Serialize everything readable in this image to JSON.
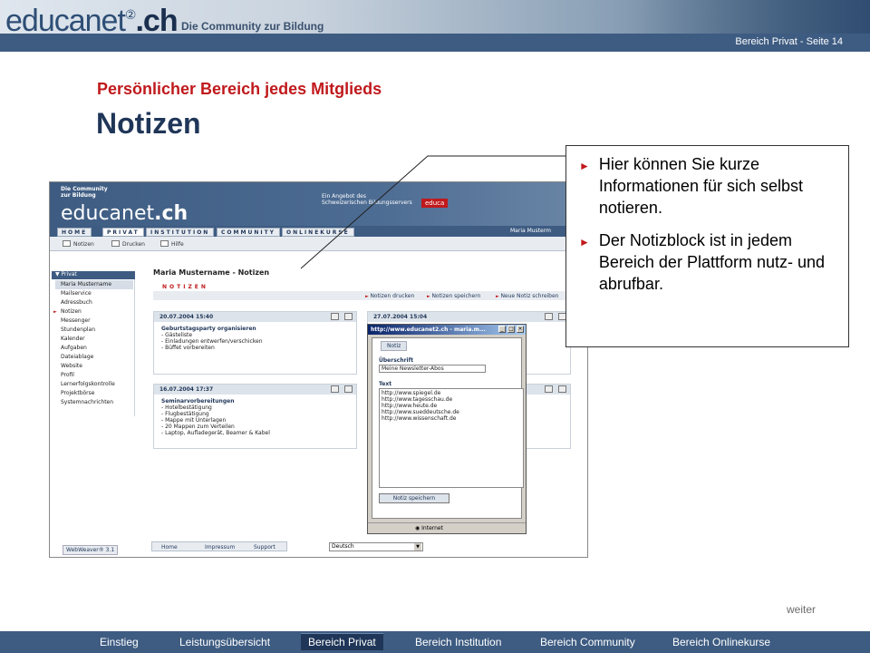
{
  "header": {
    "logo_main": "educanet",
    "logo_sup": "②",
    "logo_tld": ".ch",
    "tagline": "Die Community zur Bildung",
    "page_info": "Bereich Privat  - Seite 14"
  },
  "slide": {
    "subtitle": "Persönlicher Bereich jedes Mitglieds",
    "title": "Notizen",
    "next_link": "weiter"
  },
  "callout": {
    "items": [
      "Hier können Sie kurze Informationen für sich selbst notieren.",
      "Der Notizblock ist in jedem Bereich der Plattform nutz- und abrufbar."
    ]
  },
  "bottom_nav": {
    "items": [
      "Einstieg",
      "Leistungsübersicht",
      "Bereich Privat",
      "Bereich Institution",
      "Bereich Community",
      "Bereich Onlinekurse"
    ],
    "active": "Bereich Privat"
  },
  "screenshot": {
    "community_line1": "Die Community",
    "community_line2": "zur Bildung",
    "logo": "educanet",
    "logo_tld": ".ch",
    "offer_line1": "Ein Angebot des",
    "offer_line2": "Schweizerischen Bildungsservers",
    "educa": "educa",
    "tabs": [
      "HOME",
      "PRIVAT",
      "INSTITUTION",
      "COMMUNITY",
      "ONLINEKURSE"
    ],
    "user": "Maria Musterm",
    "toolbar": [
      "Notizen",
      "Drucken",
      "Hilfe"
    ],
    "sidebar_head": "▼ Privat",
    "sidebar_items": [
      "Maria Mustername",
      "Mailservice",
      "Adressbuch",
      "Notizen",
      "Messenger",
      "Stundenplan",
      "Kalender",
      "Aufgaben",
      "Dateiablage",
      "Website",
      "Profil",
      "Lernerfolgskontrolle",
      "Projektbörse",
      "Systemnachrichten"
    ],
    "page_title": "Maria Mustername - Notizen",
    "section": "NOTIZEN",
    "actions": [
      "Notizen drucken",
      "Notizen speichern",
      "Neue Notiz schreiben"
    ],
    "notes": [
      {
        "date": "20.07.2004 15:40",
        "title": "Geburtstagsparty organisieren",
        "lines": [
          "- Gästeliste",
          "- Einladungen entwerfen/verschicken",
          "- Büffet vorbereiten"
        ]
      },
      {
        "date": "27.07.2004 15:04",
        "title": "",
        "lines": []
      },
      {
        "date": "16.07.2004 17:37",
        "title": "Seminarvorbereitungen",
        "lines": [
          "- Hotelbestätigung",
          "- Flugbestätigung",
          "- Mappe mit Unterlagen",
          "- 20 Mappen zum Verteilen",
          "- Laptop, Aufladegerät, Beamer & Kabel"
        ]
      }
    ],
    "popup": {
      "title": "http://www.educanet2.ch - maria.m...",
      "tab": "Notiz",
      "heading_label": "Überschrift",
      "heading_value": "Meine Newsletter-Abos",
      "text_label": "Text",
      "text_lines": [
        "http://www.spiegel.de",
        "http://www.tagesschau.de",
        "http://www.heute.de",
        "http://www.sueddeutsche.de",
        "http://www.wissenschaft.de"
      ],
      "save": "Notiz speichern",
      "status": "Internet"
    },
    "footer_links": [
      "Home",
      "Impressum",
      "Support"
    ],
    "webweaver": "WebWeaver® 3.1",
    "language": "Deutsch"
  }
}
